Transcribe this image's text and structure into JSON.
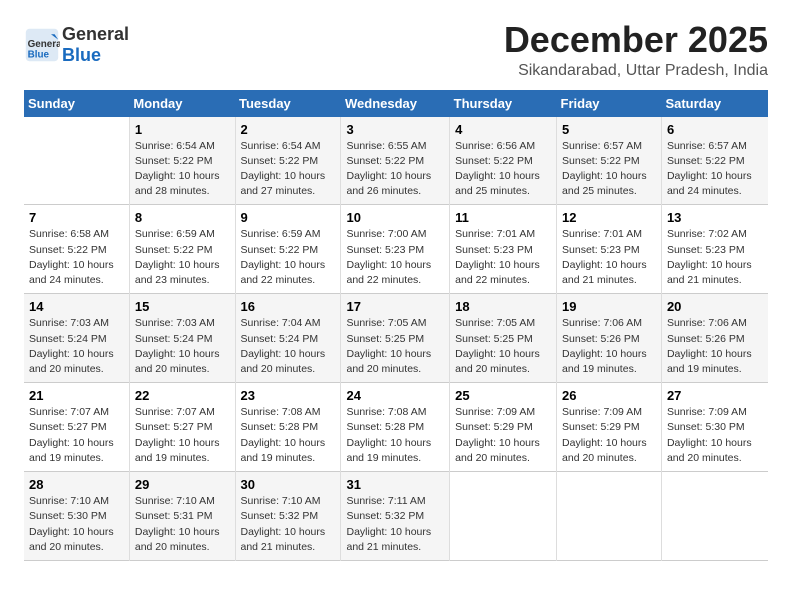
{
  "header": {
    "logo_general": "General",
    "logo_blue": "Blue",
    "title": "December 2025",
    "location": "Sikandarabad, Uttar Pradesh, India"
  },
  "days_of_week": [
    "Sunday",
    "Monday",
    "Tuesday",
    "Wednesday",
    "Thursday",
    "Friday",
    "Saturday"
  ],
  "weeks": [
    [
      {
        "day": "",
        "info": ""
      },
      {
        "day": "1",
        "info": "Sunrise: 6:54 AM\nSunset: 5:22 PM\nDaylight: 10 hours\nand 28 minutes."
      },
      {
        "day": "2",
        "info": "Sunrise: 6:54 AM\nSunset: 5:22 PM\nDaylight: 10 hours\nand 27 minutes."
      },
      {
        "day": "3",
        "info": "Sunrise: 6:55 AM\nSunset: 5:22 PM\nDaylight: 10 hours\nand 26 minutes."
      },
      {
        "day": "4",
        "info": "Sunrise: 6:56 AM\nSunset: 5:22 PM\nDaylight: 10 hours\nand 25 minutes."
      },
      {
        "day": "5",
        "info": "Sunrise: 6:57 AM\nSunset: 5:22 PM\nDaylight: 10 hours\nand 25 minutes."
      },
      {
        "day": "6",
        "info": "Sunrise: 6:57 AM\nSunset: 5:22 PM\nDaylight: 10 hours\nand 24 minutes."
      }
    ],
    [
      {
        "day": "7",
        "info": "Sunrise: 6:58 AM\nSunset: 5:22 PM\nDaylight: 10 hours\nand 24 minutes."
      },
      {
        "day": "8",
        "info": "Sunrise: 6:59 AM\nSunset: 5:22 PM\nDaylight: 10 hours\nand 23 minutes."
      },
      {
        "day": "9",
        "info": "Sunrise: 6:59 AM\nSunset: 5:22 PM\nDaylight: 10 hours\nand 22 minutes."
      },
      {
        "day": "10",
        "info": "Sunrise: 7:00 AM\nSunset: 5:23 PM\nDaylight: 10 hours\nand 22 minutes."
      },
      {
        "day": "11",
        "info": "Sunrise: 7:01 AM\nSunset: 5:23 PM\nDaylight: 10 hours\nand 22 minutes."
      },
      {
        "day": "12",
        "info": "Sunrise: 7:01 AM\nSunset: 5:23 PM\nDaylight: 10 hours\nand 21 minutes."
      },
      {
        "day": "13",
        "info": "Sunrise: 7:02 AM\nSunset: 5:23 PM\nDaylight: 10 hours\nand 21 minutes."
      }
    ],
    [
      {
        "day": "14",
        "info": "Sunrise: 7:03 AM\nSunset: 5:24 PM\nDaylight: 10 hours\nand 20 minutes."
      },
      {
        "day": "15",
        "info": "Sunrise: 7:03 AM\nSunset: 5:24 PM\nDaylight: 10 hours\nand 20 minutes."
      },
      {
        "day": "16",
        "info": "Sunrise: 7:04 AM\nSunset: 5:24 PM\nDaylight: 10 hours\nand 20 minutes."
      },
      {
        "day": "17",
        "info": "Sunrise: 7:05 AM\nSunset: 5:25 PM\nDaylight: 10 hours\nand 20 minutes."
      },
      {
        "day": "18",
        "info": "Sunrise: 7:05 AM\nSunset: 5:25 PM\nDaylight: 10 hours\nand 20 minutes."
      },
      {
        "day": "19",
        "info": "Sunrise: 7:06 AM\nSunset: 5:26 PM\nDaylight: 10 hours\nand 19 minutes."
      },
      {
        "day": "20",
        "info": "Sunrise: 7:06 AM\nSunset: 5:26 PM\nDaylight: 10 hours\nand 19 minutes."
      }
    ],
    [
      {
        "day": "21",
        "info": "Sunrise: 7:07 AM\nSunset: 5:27 PM\nDaylight: 10 hours\nand 19 minutes."
      },
      {
        "day": "22",
        "info": "Sunrise: 7:07 AM\nSunset: 5:27 PM\nDaylight: 10 hours\nand 19 minutes."
      },
      {
        "day": "23",
        "info": "Sunrise: 7:08 AM\nSunset: 5:28 PM\nDaylight: 10 hours\nand 19 minutes."
      },
      {
        "day": "24",
        "info": "Sunrise: 7:08 AM\nSunset: 5:28 PM\nDaylight: 10 hours\nand 19 minutes."
      },
      {
        "day": "25",
        "info": "Sunrise: 7:09 AM\nSunset: 5:29 PM\nDaylight: 10 hours\nand 20 minutes."
      },
      {
        "day": "26",
        "info": "Sunrise: 7:09 AM\nSunset: 5:29 PM\nDaylight: 10 hours\nand 20 minutes."
      },
      {
        "day": "27",
        "info": "Sunrise: 7:09 AM\nSunset: 5:30 PM\nDaylight: 10 hours\nand 20 minutes."
      }
    ],
    [
      {
        "day": "28",
        "info": "Sunrise: 7:10 AM\nSunset: 5:30 PM\nDaylight: 10 hours\nand 20 minutes."
      },
      {
        "day": "29",
        "info": "Sunrise: 7:10 AM\nSunset: 5:31 PM\nDaylight: 10 hours\nand 20 minutes."
      },
      {
        "day": "30",
        "info": "Sunrise: 7:10 AM\nSunset: 5:32 PM\nDaylight: 10 hours\nand 21 minutes."
      },
      {
        "day": "31",
        "info": "Sunrise: 7:11 AM\nSunset: 5:32 PM\nDaylight: 10 hours\nand 21 minutes."
      },
      {
        "day": "",
        "info": ""
      },
      {
        "day": "",
        "info": ""
      },
      {
        "day": "",
        "info": ""
      }
    ]
  ]
}
